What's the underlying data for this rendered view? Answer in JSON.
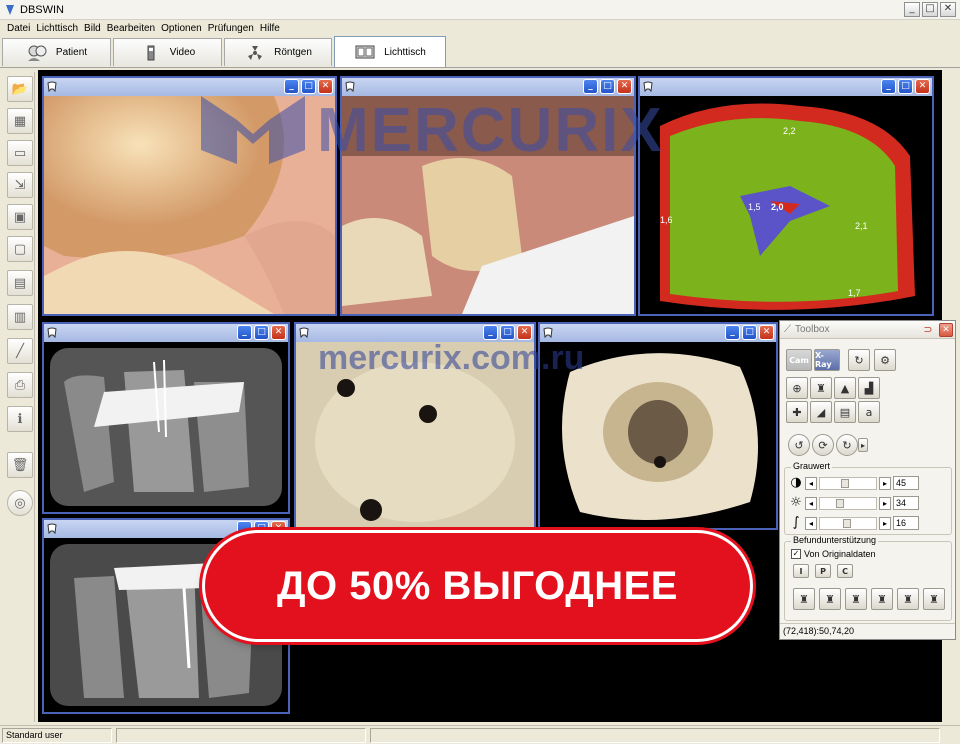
{
  "window": {
    "title": "DBSWIN",
    "minimize": "_",
    "maximize": "□",
    "close": "✕"
  },
  "menu": [
    "Datei",
    "Lichttisch",
    "Bild",
    "Bearbeiten",
    "Optionen",
    "Prüfungen",
    "Hilfe"
  ],
  "tabs": [
    {
      "label": "Patient",
      "icon": "patient-icon"
    },
    {
      "label": "Video",
      "icon": "video-camera-icon"
    },
    {
      "label": "Röntgen",
      "icon": "radiation-icon"
    },
    {
      "label": "Lichttisch",
      "icon": "lightbox-icon",
      "active": true
    }
  ],
  "left_toolbar": [
    "open-folder-icon",
    "save-stack-icon",
    "blank-frame-icon",
    "import-icon",
    "save-icon",
    "lock-icon",
    "monitor-icon",
    "document-icon",
    "measure-icon",
    "print-icon",
    "info-icon",
    "trash-icon",
    "target-icon"
  ],
  "image_windows": [
    {
      "id": "tooth-photo-1",
      "kind": "intraoral photo"
    },
    {
      "id": "tooth-photo-2",
      "kind": "intraoral photo"
    },
    {
      "id": "caries-map",
      "kind": "fluorescence map",
      "labels": [
        "2,2",
        "1,6",
        "1,5",
        "2,0",
        "2,1",
        "1,7"
      ]
    },
    {
      "id": "xray-1",
      "kind": "x-ray"
    },
    {
      "id": "canal-1",
      "kind": "endo photo"
    },
    {
      "id": "canal-2",
      "kind": "endo photo"
    },
    {
      "id": "xray-2",
      "kind": "x-ray"
    }
  ],
  "toolbox": {
    "title": "Toolbox",
    "cam_label": "Cam",
    "xray_label": "X-Ray",
    "grauwert_label": "Grauwert",
    "sliders": [
      {
        "icon": "contrast-icon",
        "value": "45",
        "level": 0.45
      },
      {
        "icon": "brightness-icon",
        "value": "34",
        "level": 0.34
      },
      {
        "icon": "gamma-icon",
        "value": "16",
        "level": 0.5
      }
    ],
    "befund_label": "Befundunterstützung",
    "original_checkbox_label": "Von Originaldaten",
    "original_checked": true,
    "mode_buttons": [
      "I",
      "P",
      "C"
    ],
    "status": "(72,418):50,74,20"
  },
  "statusbar": {
    "user": "Standard user"
  },
  "watermark": {
    "brand": "MERCURIX",
    "url": "mercurix.com.ru"
  },
  "promo": {
    "text": "ДО 50% ВЫГОДНЕЕ"
  },
  "colors": {
    "workspace": "#000000",
    "window_border": "#4a63b8",
    "promo": "#e3111d",
    "watermark": "#3a4fa8"
  }
}
